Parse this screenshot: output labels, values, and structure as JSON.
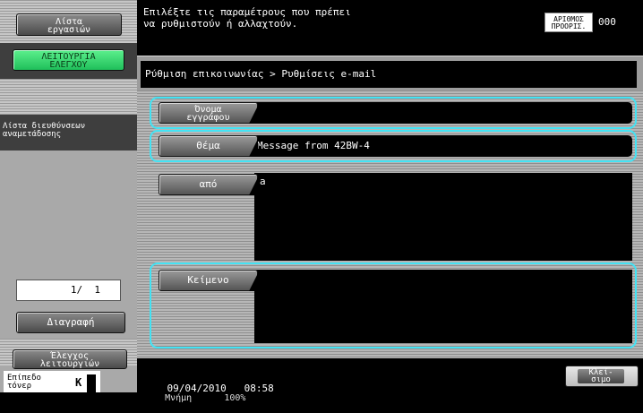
{
  "sidebar": {
    "job_list_label": "Λίστα\nεργασιών",
    "utility_label": "ΛΕΙΤΟΥΡΓΙΑ\nΕΛΕΓΧΟΥ",
    "address_list_title": "Λίστα διευθύνσεων\nαναμετάδοσης",
    "page_indicator": "1/  1",
    "delete_label": "Διαγραφή",
    "function_check_label": "Έλεγχος\nλειτουργιών",
    "toner_label": "Επίπεδο\nτόνερ",
    "toner_color": "K"
  },
  "topbar": {
    "prompt": "Επιλέξτε τις παραμέτρους που πρέπει\nνα ρυθμιστούν ή αλλαχτούν.",
    "counter_label": "ΑΡΙΘΜΟΣ\nΠΡΟΟΡΙΣ.",
    "counter_value": "000"
  },
  "main": {
    "breadcrumb": "Ρύθμιση επικοινωνίας > Ρυθμίσεις e-mail",
    "fields": {
      "document_name": {
        "label": "Όνομα\nεγγράφου",
        "value": ""
      },
      "subject": {
        "label": "Θέμα",
        "value": "Message from 42BW-4"
      },
      "from": {
        "label": "από",
        "value": "a"
      },
      "body": {
        "label": "Κείμενο",
        "value": ""
      }
    }
  },
  "status": {
    "date": "09/04/2010",
    "time": "08:58",
    "memory_label": "Μνήμη",
    "memory_value": "100%",
    "close_label": "Κλεί-\nσιμο"
  },
  "colors": {
    "highlight_ring": "#43e3f4",
    "utility_green": "#2ed16a"
  }
}
